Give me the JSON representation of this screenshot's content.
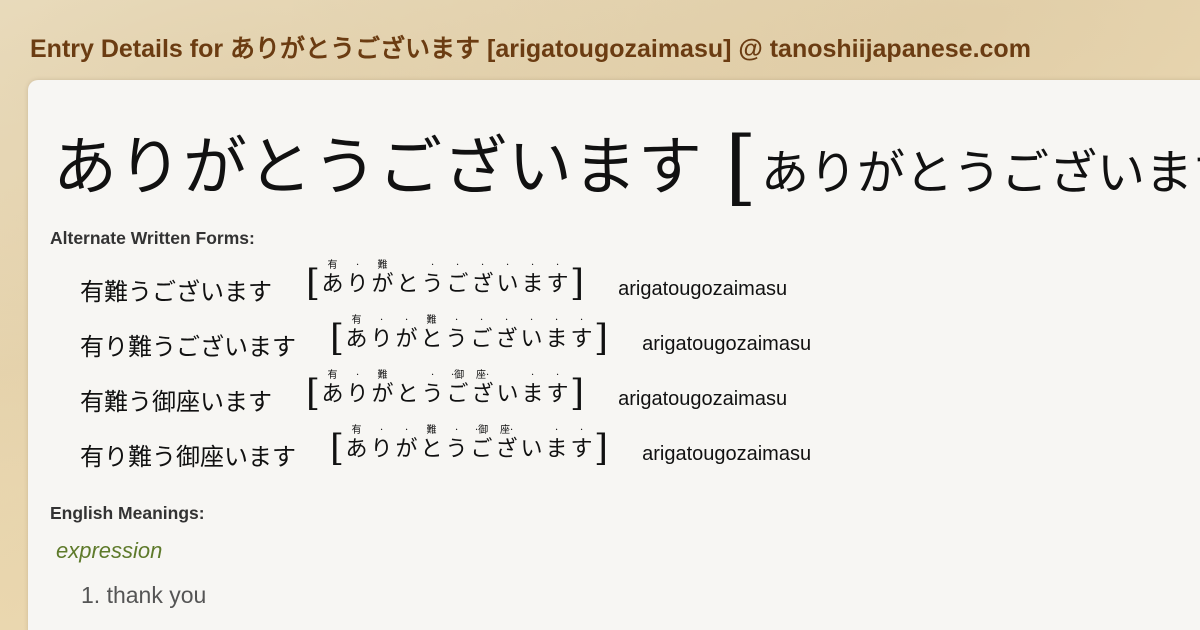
{
  "header": {
    "title": "Entry Details for ありがとうございます [arigatougozaimasu] @ tanoshiijapanese.com"
  },
  "entry": {
    "headword": "ありがとうございます",
    "bracket_open": "[",
    "reading": "ありがとうございます"
  },
  "alternate_forms": {
    "label": "Alternate Written Forms:",
    "items": [
      {
        "kanji": "有難うございます",
        "bracket_open": "[",
        "bracket_close": "]",
        "kana": [
          "あ",
          "り",
          "が",
          "と",
          "う",
          "ご",
          "ざ",
          "い",
          "ま",
          "す"
        ],
        "furigana": [
          "有",
          "·",
          "難",
          "",
          "·",
          "·",
          "·",
          "·",
          "·",
          "·"
        ],
        "romaji": "arigatougozaimasu"
      },
      {
        "kanji": "有り難うございます",
        "bracket_open": "[",
        "bracket_close": "]",
        "kana": [
          "あ",
          "り",
          "が",
          "と",
          "う",
          "ご",
          "ざ",
          "い",
          "ま",
          "す"
        ],
        "furigana": [
          "有",
          "·",
          "·",
          "難",
          "·",
          "·",
          "·",
          "·",
          "·",
          "·"
        ],
        "romaji": "arigatougozaimasu"
      },
      {
        "kanji": "有難う御座います",
        "bracket_open": "[",
        "bracket_close": "]",
        "kana": [
          "あ",
          "り",
          "が",
          "と",
          "う",
          "ご",
          "ざ",
          "い",
          "ま",
          "す"
        ],
        "furigana": [
          "有",
          "·",
          "難",
          "",
          "·",
          "·御",
          "座·",
          "",
          "·",
          "·"
        ],
        "romaji": "arigatougozaimasu"
      },
      {
        "kanji": "有り難う御座います",
        "bracket_open": "[",
        "bracket_close": "]",
        "kana": [
          "あ",
          "り",
          "が",
          "と",
          "う",
          "ご",
          "ざ",
          "い",
          "ま",
          "す"
        ],
        "furigana": [
          "有",
          "·",
          "·",
          "難",
          "·",
          "·御",
          "座·",
          "",
          "·",
          "·"
        ],
        "romaji": "arigatougozaimasu"
      }
    ]
  },
  "meanings": {
    "label": "English Meanings:",
    "part_of_speech": "expression",
    "items": [
      "1. thank you"
    ]
  },
  "colors": {
    "header_text": "#6b3c12",
    "pos_text": "#5e7a2a",
    "card_bg": "#f7f6f3"
  }
}
